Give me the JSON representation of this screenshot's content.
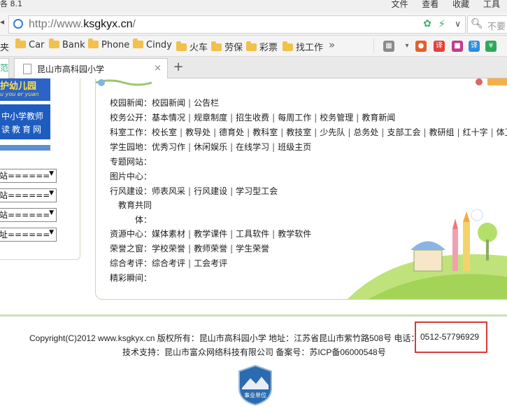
{
  "window": {
    "version_fragment": "各 8.1",
    "menu": [
      "文件",
      "查看",
      "收藏",
      "工具"
    ]
  },
  "address": {
    "url_prefix": "http://www.",
    "url_domain": "ksgkyx.cn",
    "url_suffix": "/",
    "search_placeholder": "不要"
  },
  "bookmarks": [
    {
      "label": "夹",
      "folder": false
    },
    {
      "label": "Car",
      "folder": true
    },
    {
      "label": "Bank",
      "folder": true
    },
    {
      "label": "Phone",
      "folder": true
    },
    {
      "label": "Cindy",
      "folder": true
    },
    {
      "label": "火车",
      "folder": true
    },
    {
      "label": "劳保",
      "folder": true
    },
    {
      "label": "彩票",
      "folder": true
    },
    {
      "label": "找工作",
      "folder": true
    }
  ],
  "bookmarks_more": "»",
  "tabs": {
    "prev_fragment": "范",
    "active_title": "昆山市高科园小学",
    "close": "×",
    "new_tab": "+"
  },
  "left": {
    "banner1_line1": "护幼儿园",
    "banner1_line2": "u you er yuan",
    "banner2_line1": "中小学教师",
    "banner2_line2": "读教育网",
    "selects": [
      "站======",
      "站======",
      "站======",
      "址======"
    ]
  },
  "nav": [
    {
      "label": "校园新闻：",
      "links": [
        "校园新闻",
        "公告栏"
      ]
    },
    {
      "label": "校务公开：",
      "links": [
        "基本情况",
        "规章制度",
        "招生收费",
        "每周工作",
        "校务管理",
        "教育新闻"
      ]
    },
    {
      "label": "科室工作：",
      "links": [
        "校长室",
        "教导处",
        "德育处",
        "教科室",
        "教技室",
        "少先队",
        "总务处",
        "支部工会",
        "教研组",
        "红十字",
        "体卫"
      ]
    },
    {
      "label": "学生园地：",
      "links": [
        "优秀习作",
        "休闲娱乐",
        "在线学习",
        "班级主页"
      ]
    },
    {
      "label": "专题网站：",
      "links": []
    },
    {
      "label": "图片中心：",
      "links": []
    },
    {
      "label": "行风建设：",
      "links": [
        "师表风采",
        "行风建设",
        "学习型工会"
      ]
    },
    {
      "label": "教育共同",
      "label2": "体：",
      "links": []
    },
    {
      "label": "资源中心：",
      "links": [
        "媒体素材",
        "教学课件",
        "工具软件",
        "教学软件"
      ]
    },
    {
      "label": "荣誉之窗：",
      "links": [
        "学校荣誉",
        "教师荣誉",
        "学生荣誉"
      ]
    },
    {
      "label": "综合考评：",
      "links": [
        "综合考评",
        "工会考评"
      ]
    },
    {
      "label": "精彩瞬间：",
      "links": []
    }
  ],
  "footer": {
    "line1": "Copyright(C)2012 www.ksgkyx.cn 版权所有：昆山市高科园小学 地址：江苏省昆山市紫竹路508号 电话：",
    "phone": "0512-57796929",
    "line2": "技术支持：昆山市富众网络科技有限公司 备案号：苏ICP备06000548号",
    "badge_text": "事业单位"
  },
  "colors": {
    "highlight_box": "#d9383a",
    "link": "#1c1c1c",
    "banner_blue": "#1f5cc0"
  }
}
